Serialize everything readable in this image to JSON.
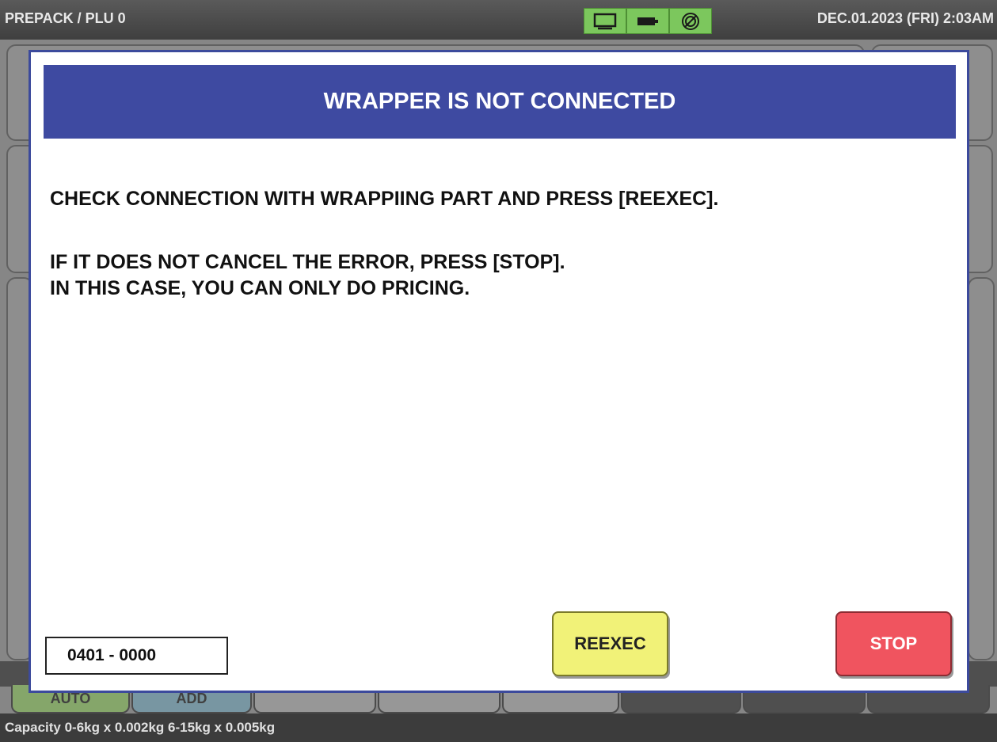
{
  "topbar": {
    "title": "PREPACK / PLU 0",
    "datetime": "DEC.01.2023 (FRI)  2:03AM",
    "icons": [
      "monitor-icon",
      "battery-icon",
      "network-icon"
    ]
  },
  "bottom_tabs": {
    "auto_label": "AUTO",
    "add_label": "ADD"
  },
  "statusbar": {
    "capacity": "Capacity 0-6kg x 0.002kg  6-15kg x 0.005kg"
  },
  "dialog": {
    "title": "WRAPPER IS NOT CONNECTED",
    "line1": "CHECK CONNECTION WITH WRAPPIING PART AND PRESS [REEXEC].",
    "line2": "IF IT DOES NOT CANCEL THE ERROR, PRESS [STOP].",
    "line3": "IN THIS CASE, YOU CAN ONLY DO PRICING.",
    "error_code": "0401 - 0000",
    "reexec_label": "REEXEC",
    "stop_label": "STOP"
  },
  "colors": {
    "header_blue": "#3e4aa1",
    "reexec_yellow": "#f1f278",
    "stop_red": "#f0545f",
    "status_green": "#7cc75d",
    "auto_tab_green": "#8cbf63",
    "add_tab_blue": "#79a7b8"
  }
}
